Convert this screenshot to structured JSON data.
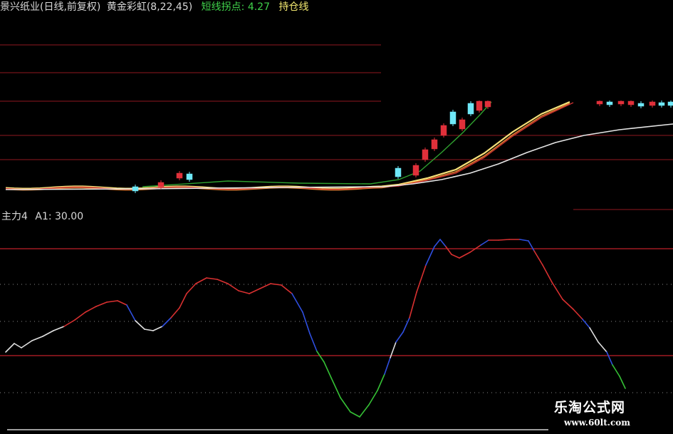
{
  "header": {
    "stock": "景兴纸业(日线,前复权)",
    "indicator": "黄金彩虹(8,22,45)",
    "pivot_label": "短线拐点: 4.27",
    "hold_label": "持仓线"
  },
  "sub_header": {
    "indicator": "主力4",
    "a1_label": "A1: 30.00"
  },
  "watermark": {
    "name": "乐淘公式网",
    "url": "www.60lt.com"
  },
  "colors": {
    "background": "#000000",
    "grid_red": "#c0202a",
    "grid_dot": "#8a8a8a",
    "up_candle": "#e0303a",
    "down_candle": "#6fe8f8",
    "ma_yellow": "#f7e27a",
    "ma_orange": "#e08030",
    "ma_red": "#c83030",
    "ma_white": "#e6e6e6",
    "ma_green": "#2fa02f",
    "line_white": "#e0e0e0",
    "line_red": "#d83030",
    "line_blue": "#2f4fe0",
    "line_green": "#35c035"
  },
  "chart_data": [
    {
      "type": "line",
      "name": "price-panel",
      "series": [
        {
          "color": "#ff9d2f",
          "values": []
        }
      ]
    },
    {
      "type": "line",
      "name": "oscillator-panel",
      "values": [],
      "reference_lines": [
        30
      ]
    }
  ]
}
